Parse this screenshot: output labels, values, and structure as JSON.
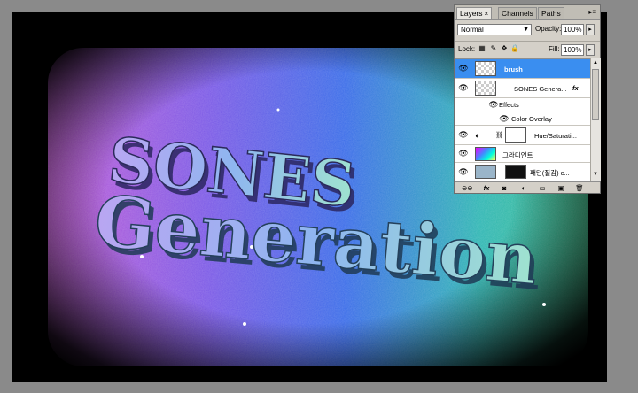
{
  "canvas": {
    "headline_line1": "SONES",
    "headline_line2": "Generation"
  },
  "layers_panel": {
    "tabs": [
      {
        "label": "Layers",
        "active": true,
        "close": "×"
      },
      {
        "label": "Channels",
        "active": false
      },
      {
        "label": "Paths",
        "active": false
      }
    ],
    "menu_glyph": "▸≡",
    "close_glyph": "×",
    "blend_mode": "Normal",
    "opacity_label": "Opacity:",
    "opacity_value": "100%",
    "lock_label": "Lock:",
    "fill_label": "Fill:",
    "fill_value": "100%",
    "layers": [
      {
        "name": "brush",
        "selected": true,
        "visible": true,
        "thumb": "checker"
      },
      {
        "name": "SONES Genera...",
        "selected": false,
        "visible": true,
        "thumb": "checker",
        "fx": "fx"
      },
      {
        "name": "Effects",
        "sub": true,
        "visible": true
      },
      {
        "name": "Color Overlay",
        "sub2": true,
        "visible": true
      },
      {
        "name": "Hue/Saturati...",
        "selected": false,
        "visible": true,
        "thumb": "white"
      },
      {
        "name": "그라디언트",
        "selected": false,
        "visible": true,
        "thumb": "rainbow"
      },
      {
        "name": "패턴(질감) c...",
        "selected": false,
        "visible": true,
        "thumb": "pattern"
      }
    ],
    "footer_glyphs": [
      "⊖⊖",
      "fx",
      "◙",
      "◐",
      "▭",
      "▣",
      "🗑"
    ]
  },
  "colors": {
    "selection": "#3a8ef0",
    "panel_bg": "#d4d0c8",
    "workspace_bg": "#8a8a8a"
  }
}
